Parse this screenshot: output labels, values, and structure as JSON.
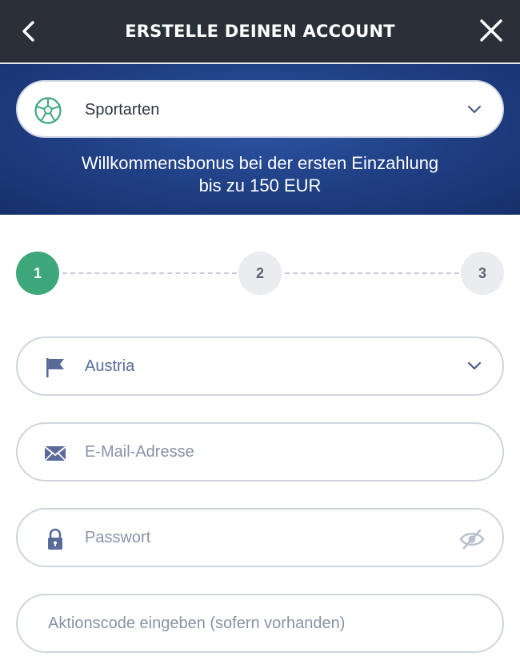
{
  "header": {
    "title": "ERSTELLE DEINEN ACCOUNT",
    "back_icon": "chevron-left-icon",
    "close_icon": "close-icon"
  },
  "banner": {
    "sport_select": {
      "label": "Sportarten",
      "icon": "soccer-ball-icon"
    },
    "bonus_line1": "Willkommensbonus bei der ersten Einzahlung",
    "bonus_line2": "bis zu 150 EUR"
  },
  "stepper": {
    "steps": [
      {
        "label": "1",
        "active": true
      },
      {
        "label": "2",
        "active": false
      },
      {
        "label": "3",
        "active": false
      }
    ]
  },
  "form": {
    "country": {
      "value": "Austria",
      "icon": "flag-icon"
    },
    "email": {
      "placeholder": "E-Mail-Adresse",
      "icon": "envelope-icon"
    },
    "password": {
      "placeholder": "Passwort",
      "icon": "lock-icon",
      "toggle_icon": "eye-slash-icon"
    },
    "promo": {
      "placeholder": "Aktionscode eingeben (sofern vorhanden)"
    }
  },
  "colors": {
    "header_bg": "#2b3038",
    "banner_bg": "#1f3e82",
    "accent_green": "#3ea77a",
    "icon_blue": "#5a6a99"
  }
}
